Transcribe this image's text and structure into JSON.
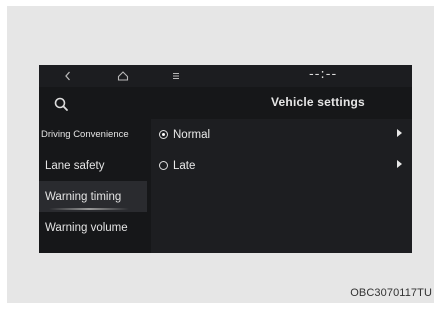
{
  "topbar": {
    "back_icon": "chevron-left-icon",
    "home_icon": "home-icon",
    "menu_icon": "menu-icon",
    "clock": "--:--"
  },
  "header": {
    "search_icon": "search-icon",
    "title": "Vehicle settings"
  },
  "sidebar": {
    "items": [
      {
        "label": "Driving Convenience",
        "selected": false
      },
      {
        "label": "Lane safety",
        "selected": false
      },
      {
        "label": "Warning timing",
        "selected": true
      },
      {
        "label": "Warning volume",
        "selected": false
      }
    ]
  },
  "options": {
    "items": [
      {
        "label": "Normal",
        "checked": true,
        "icon": "chevron-right-icon"
      },
      {
        "label": "Late",
        "checked": false,
        "icon": "chevron-right-icon"
      }
    ]
  },
  "caption": "OBC3070117TU"
}
